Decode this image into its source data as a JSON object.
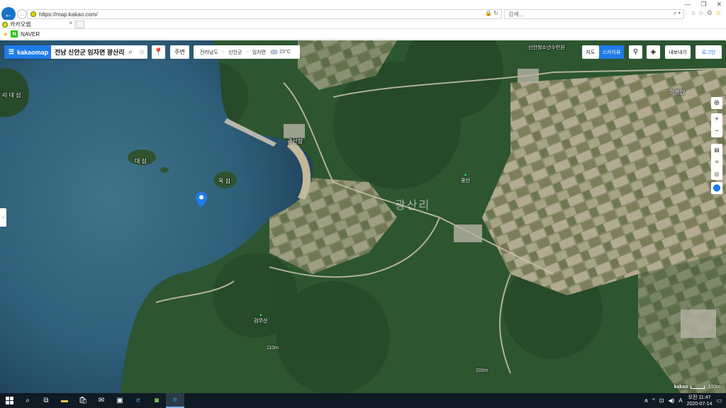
{
  "browser": {
    "url": "https://map.kakao.com/",
    "search_placeholder": "검색...",
    "tab_title": "카카오맵",
    "favorites": [
      {
        "label": "NAVER"
      }
    ],
    "window_controls": [
      "—",
      "❐",
      "✕"
    ]
  },
  "kakao": {
    "brand": "kakaomap",
    "search_query": "전남 신안군 임자면 광산리",
    "nearby_label": "주변",
    "breadcrumb": [
      "전라남도",
      "신안군",
      "임자면"
    ],
    "weather": "23°C",
    "map_btn": "지도",
    "skyview_btn": "스카이뷰",
    "mymap_btn": "내보내기",
    "login_btn": "로그인",
    "zoom_in": "+",
    "zoom_out": "−",
    "attribution": "kakao",
    "scale": "100m"
  },
  "map_labels": {
    "village": "광산리",
    "island_left": "리 대 섬",
    "island_mid": "대 섬",
    "island_small": "옥 섬",
    "port": "광산항",
    "top_right_place": "신안청소년수련원",
    "far_right": "이흑암",
    "peak_north": "광산",
    "peak_south": "검무산",
    "contour_1": "110m",
    "contour_2": "200m"
  },
  "colors": {
    "accent": "#1f7be8",
    "sea": "#2a5c78",
    "forest": "#2d5530",
    "farmland": "#9a9776"
  },
  "taskbar": {
    "time": "오전 11:47",
    "date": "2020-07-14",
    "ime": "A"
  }
}
